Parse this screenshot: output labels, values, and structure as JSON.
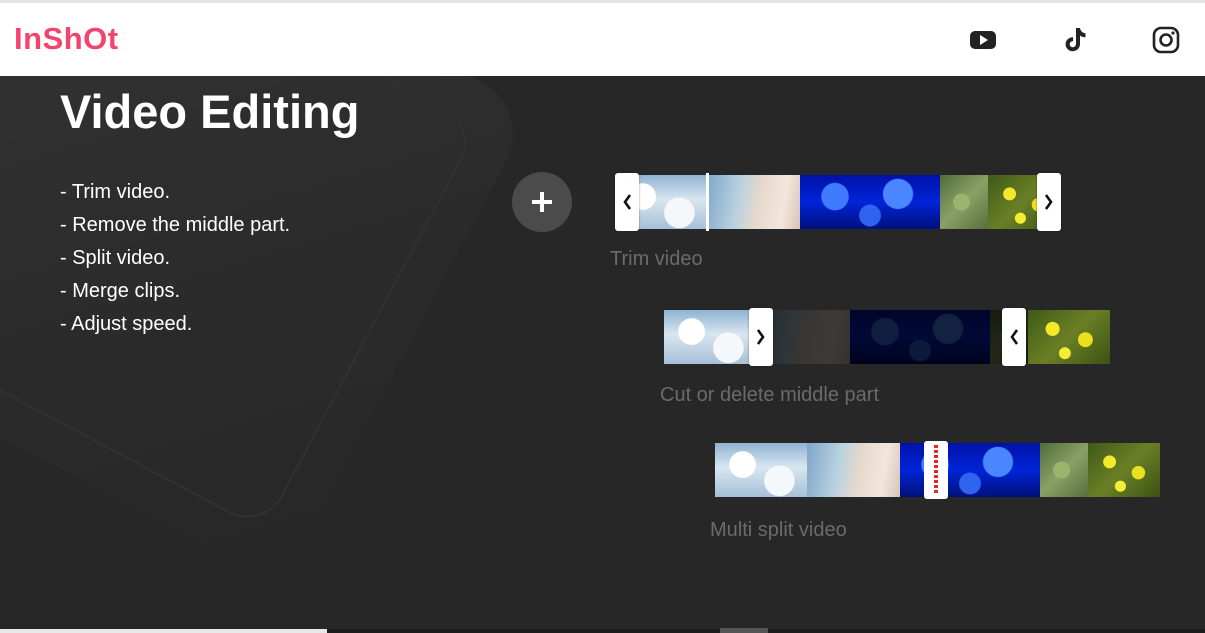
{
  "header": {
    "logo": "InShOt",
    "social": [
      {
        "name": "youtube-icon"
      },
      {
        "name": "tiktok-icon"
      },
      {
        "name": "instagram-icon"
      }
    ]
  },
  "hero": {
    "title": "Video Editing",
    "features": [
      "- Trim video.",
      "- Remove the middle part.",
      "- Split video.",
      "- Merge clips.",
      "- Adjust speed."
    ]
  },
  "demos": {
    "trim_caption": "Trim video",
    "cut_caption": "Cut or delete middle part",
    "split_caption": "Multi split video"
  },
  "colors": {
    "brand": "#f4436c",
    "background": "#272727",
    "caption": "#6b6b6b"
  }
}
